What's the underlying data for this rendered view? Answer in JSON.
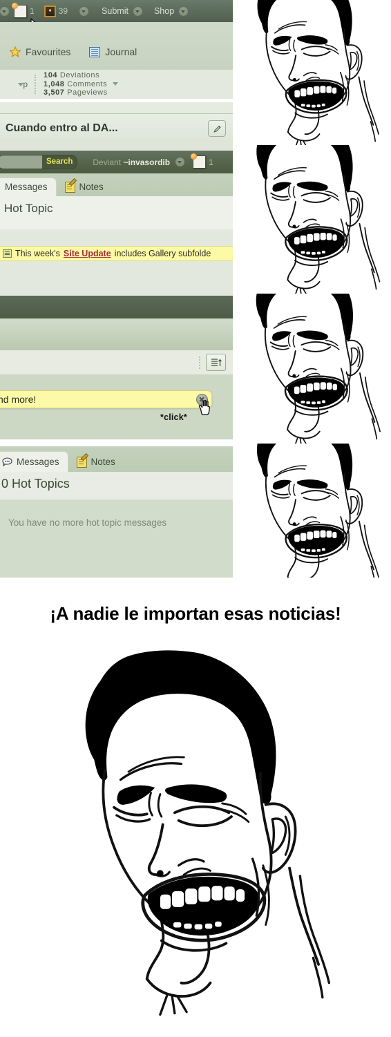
{
  "meme": {
    "caption": "¡A nadie le importan esas noticias!",
    "face_name": "yao-ming-bitch-please-rage-face",
    "click_label_top": "*click*",
    "click_label_mid": "*click*"
  },
  "da_header": {
    "notes_count": "1",
    "messages_count": "39",
    "submit_label": "Submit",
    "shop_label": "Shop"
  },
  "profile_nav": {
    "favourites_label": "Favourites",
    "journal_label": "Journal",
    "group_label": "p"
  },
  "stats": {
    "deviations_value": "104",
    "deviations_label": "Deviations",
    "comments_value": "1,048",
    "comments_label": "Comments",
    "pageviews_value": "3,507",
    "pageviews_label": "Pageviews"
  },
  "journal": {
    "title": "Cuando entro al DA..."
  },
  "searchbar": {
    "search_button": "Search",
    "search_value": "",
    "search_placeholder": "",
    "deviant_prefix": "Deviant ",
    "deviant_name": "~invasordib",
    "notes_count": "1"
  },
  "tabs_top": {
    "messages": "Messages",
    "notes": "Notes"
  },
  "hot_topic": {
    "heading": "Hot Topic",
    "banner_prefix": "This week's ",
    "banner_link": "Site Update",
    "banner_suffix": " includes Gallery subfolde"
  },
  "message_center": {
    "banner_text": "nd more!",
    "tabs": {
      "messages": "Messages",
      "notes": "Notes"
    },
    "heading": "0 Hot Topics",
    "empty_text": "You have no more hot topic messages"
  },
  "colors": {
    "dark_bar": "#5d6d5c",
    "page_green": "#cfdac9",
    "panel_light": "#eef1ea",
    "banner_yellow": "#fcfaa6",
    "link_red": "#a32d3c",
    "search_yellow": "#e3e35a"
  }
}
